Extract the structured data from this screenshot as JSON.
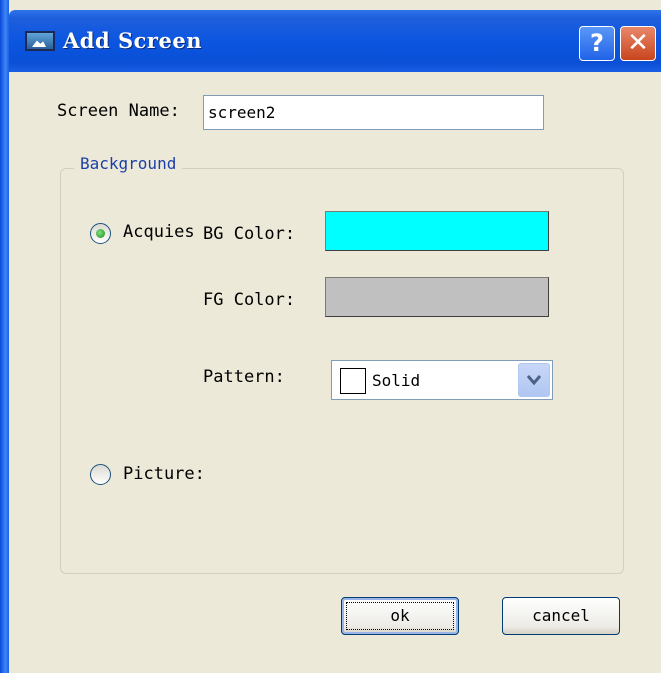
{
  "window": {
    "title": "Add Screen",
    "help_label": "?",
    "close_label": "✕",
    "icon": "window-picture-icon"
  },
  "form": {
    "screen_name_label": "Screen Name:",
    "screen_name_value": "screen2",
    "background_group_label": "Background",
    "acquies_label": "Acquies",
    "acquies_checked": true,
    "bg_color_label": "BG Color:",
    "bg_color_value": "#00ffff",
    "fg_color_label": "FG Color:",
    "fg_color_value": "#c0c0c0",
    "pattern_label": "Pattern:",
    "pattern_value": "Solid",
    "picture_label": "Picture:",
    "picture_checked": false
  },
  "buttons": {
    "ok_label": "ok",
    "cancel_label": "cancel"
  }
}
